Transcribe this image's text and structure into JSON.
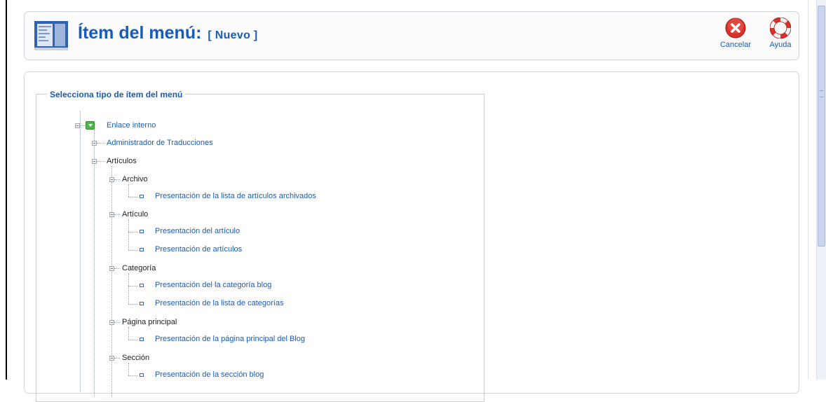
{
  "toolbar": {
    "title": "Ítem del menú:",
    "subtitle": "[ Nuevo ]",
    "cancel_label": "Cancelar",
    "help_label": "Ayuda",
    "cancel_icon": "cancel-icon",
    "help_icon": "help-lifebuoy-icon"
  },
  "panel": {
    "legend": "Selecciona tipo de ítem del menú"
  },
  "tree": {
    "root": "Enlace interno",
    "translations": "Administrador de Traducciones",
    "articles": "Artículos",
    "archive": "Archivo",
    "archive_list": "Presentación de la lista de artículos archivados",
    "article": "Artículo",
    "article_layout": "Presentación del artículo",
    "article_submission": "Presentación de artículos",
    "category": "Categoría",
    "category_blog": "Presentación del la categoría blog",
    "category_list": "Presentación de la lista de categorías",
    "frontpage": "Página principal",
    "frontpage_blog": "Presentación de la página principal del Blog",
    "section": "Sección",
    "section_blog": "Presentación de la sección blog"
  },
  "colors": {
    "link": "#1a5bb5",
    "cancel_red": "#d6322b",
    "help_red": "#d6322b",
    "root_green": "#4db848"
  }
}
